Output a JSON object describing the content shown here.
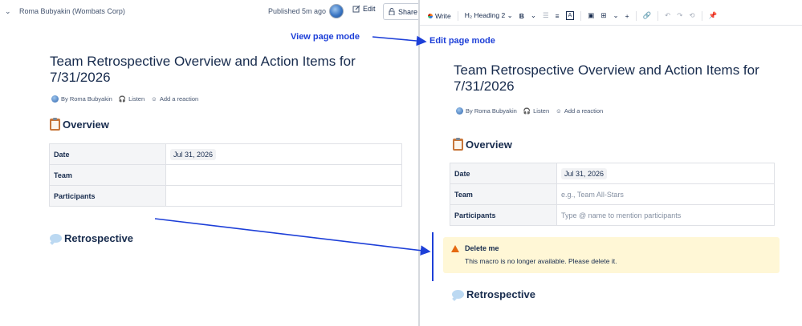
{
  "view": {
    "space_name": "Roma Bubyakin (Wombats Corp)",
    "published": "Published 5m ago",
    "edit_label": "Edit",
    "share_label": "Share",
    "title": "Team Retrospective Overview and Action Items for 7/31/2026",
    "byline": {
      "author": "By Roma Bubyakin",
      "listen": "Listen",
      "reaction": "Add a reaction"
    },
    "overview_heading": "Overview",
    "table": [
      {
        "label": "Date",
        "value": "Jul 31, 2026"
      },
      {
        "label": "Team",
        "value": ""
      },
      {
        "label": "Participants",
        "value": ""
      }
    ],
    "retro_heading": "Retrospective"
  },
  "edit": {
    "toolbar": {
      "write": "Write",
      "heading": "Heading 2",
      "bold": "B",
      "text_color": "A",
      "plus": "+"
    },
    "title": "Team Retrospective Overview and Action Items for 7/31/2026",
    "byline": {
      "author": "By Roma Bubyakin",
      "listen": "Listen",
      "reaction": "Add a reaction"
    },
    "overview_heading": "Overview",
    "table": [
      {
        "label": "Date",
        "value": "Jul 31, 2026"
      },
      {
        "label": "Team",
        "placeholder": "e.g., Team All-Stars"
      },
      {
        "label": "Participants",
        "placeholder": "Type @ name to mention participants"
      }
    ],
    "warning": {
      "title": "Delete me",
      "body": "This macro is no longer available. Please delete it."
    },
    "retro_heading": "Retrospective"
  },
  "annotations": {
    "view_mode": "View page mode",
    "edit_mode": "Edit page mode",
    "color": "#1d3fd8"
  }
}
